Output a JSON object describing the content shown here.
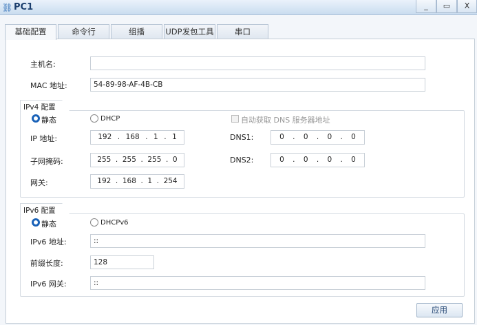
{
  "window": {
    "title": "PC1",
    "minimize": "_",
    "maximize": "▭",
    "close": "X"
  },
  "tabs": [
    "基础配置",
    "命令行",
    "组播",
    "UDP发包工具",
    "串口"
  ],
  "basic": {
    "hostname_label": "主机名:",
    "hostname": "",
    "mac_label": "MAC 地址:",
    "mac": "54-89-98-AF-4B-CB"
  },
  "ipv4": {
    "title": "IPv4 配置",
    "static": "静态",
    "dhcp": "DHCP",
    "auto_dns": "自动获取 DNS 服务器地址",
    "ip_label": "IP 地址:",
    "ip": [
      "192",
      "168",
      "1",
      "1"
    ],
    "mask_label": "子网掩码:",
    "mask": [
      "255",
      "255",
      "255",
      "0"
    ],
    "gw_label": "网关:",
    "gw": [
      "192",
      "168",
      "1",
      "254"
    ],
    "dns1_label": "DNS1:",
    "dns1": [
      "0",
      "0",
      "0",
      "0"
    ],
    "dns2_label": "DNS2:",
    "dns2": [
      "0",
      "0",
      "0",
      "0"
    ]
  },
  "ipv6": {
    "title": "IPv6 配置",
    "static": "静态",
    "dhcp": "DHCPv6",
    "addr_label": "IPv6 地址:",
    "addr": "::",
    "prefix_label": "前缀长度:",
    "prefix": "128",
    "gw_label": "IPv6 网关:",
    "gw": "::"
  },
  "apply": "应用"
}
